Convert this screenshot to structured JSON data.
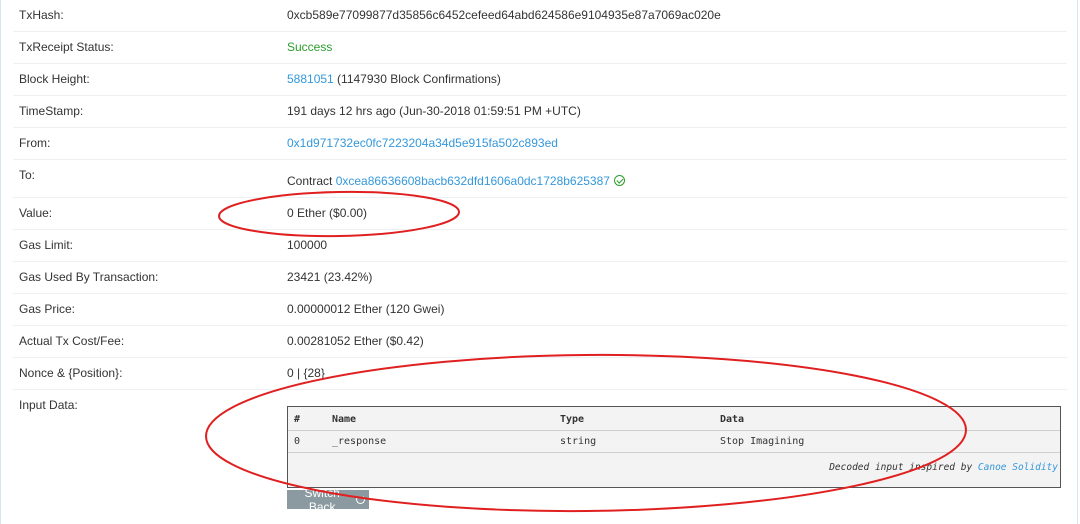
{
  "rows": [
    {
      "label": "TxHash:",
      "value": "0xcb589e77099877d35856c6452cefeed64abd624586e9104935e87a7069ac020e"
    },
    {
      "label": "TxReceipt Status:",
      "value": "Success"
    },
    {
      "label": "Block Height:",
      "block": "5881051",
      "confirmations": " (1147930 Block Confirmations)"
    },
    {
      "label": "TimeStamp:",
      "value": "191 days 12 hrs ago (Jun-30-2018 01:59:51 PM +UTC)"
    },
    {
      "label": "From:",
      "value": "0x1d971732ec0fc7223204a34d5e915fa502c893ed"
    },
    {
      "label": "To:",
      "prefix": "Contract ",
      "address": "0xcea86636608bacb632dfd1606a0dc1728b625387"
    },
    {
      "label": "Value:",
      "value": "0 Ether ($0.00)"
    },
    {
      "label": "Gas Limit:",
      "value": "100000"
    },
    {
      "label": "Gas Used By Transaction:",
      "value": "23421 (23.42%)"
    },
    {
      "label": "Gas Price:",
      "value": "0.00000012 Ether (120 Gwei)"
    },
    {
      "label": "Actual Tx Cost/Fee:",
      "value": "0.00281052 Ether ($0.42)"
    },
    {
      "label": "Nonce & {Position}:",
      "value": "0 | {28}"
    },
    {
      "label": "Input Data:"
    }
  ],
  "input_table": {
    "headers": [
      "#",
      "Name",
      "Type",
      "Data"
    ],
    "rows": [
      [
        "0",
        "_response",
        "string",
        "Stop Imagining"
      ]
    ],
    "decoded_prefix": "Decoded input inspired by ",
    "decoded_link": "Canoe Solidity"
  },
  "switch_button": "Switch Back",
  "colors": {
    "link": "#3498db",
    "success": "#2a9d2a",
    "annotation": "#e02020"
  }
}
